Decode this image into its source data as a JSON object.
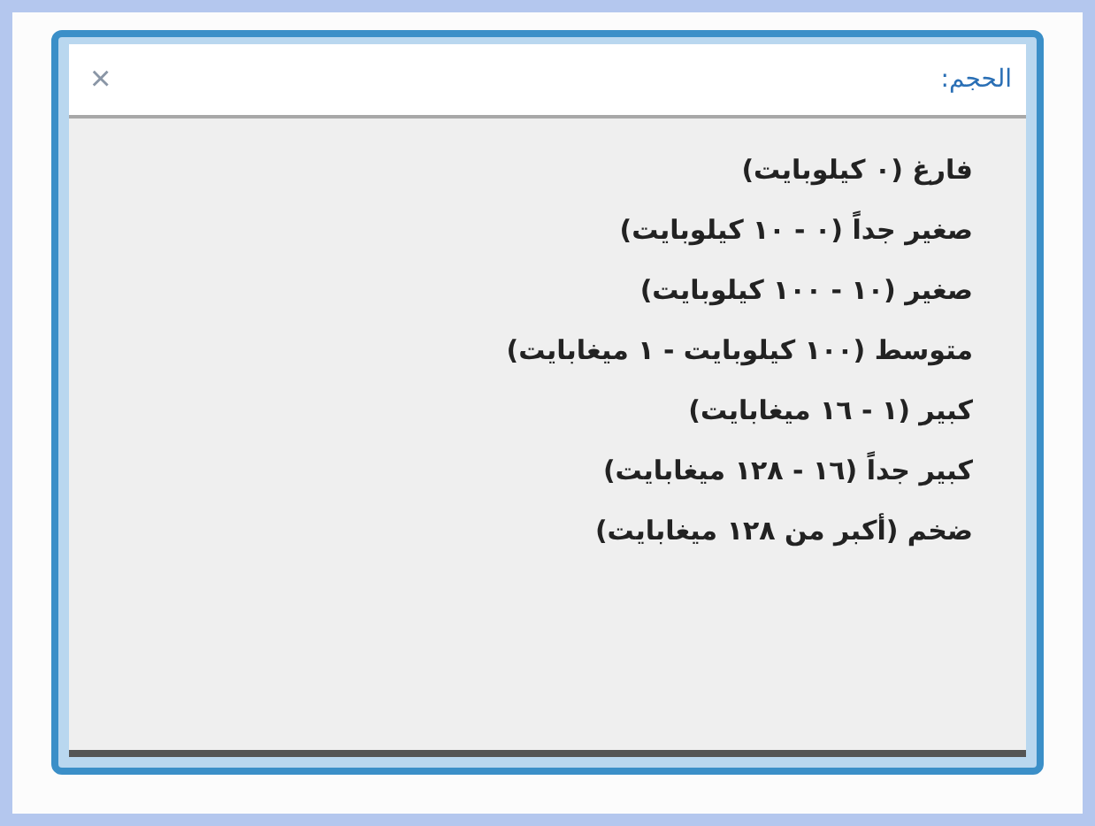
{
  "filter": {
    "label": "الحجم:",
    "close": "×"
  },
  "options": [
    {
      "label": "فارغ (٠ كيلوبايت)"
    },
    {
      "label": "صغير جداً (٠ - ١٠ كيلوبايت)"
    },
    {
      "label": "صغير (١٠ - ١٠٠ كيلوبايت)"
    },
    {
      "label": "متوسط (١٠٠ كيلوبايت - ١ ميغابايت)"
    },
    {
      "label": "كبير (١ - ١٦ ميغابايت)"
    },
    {
      "label": "كبير جداً (١٦ - ١٢٨ ميغابايت)"
    },
    {
      "label": "ضخم (أكبر من ١٢٨ ميغابايت)"
    }
  ]
}
